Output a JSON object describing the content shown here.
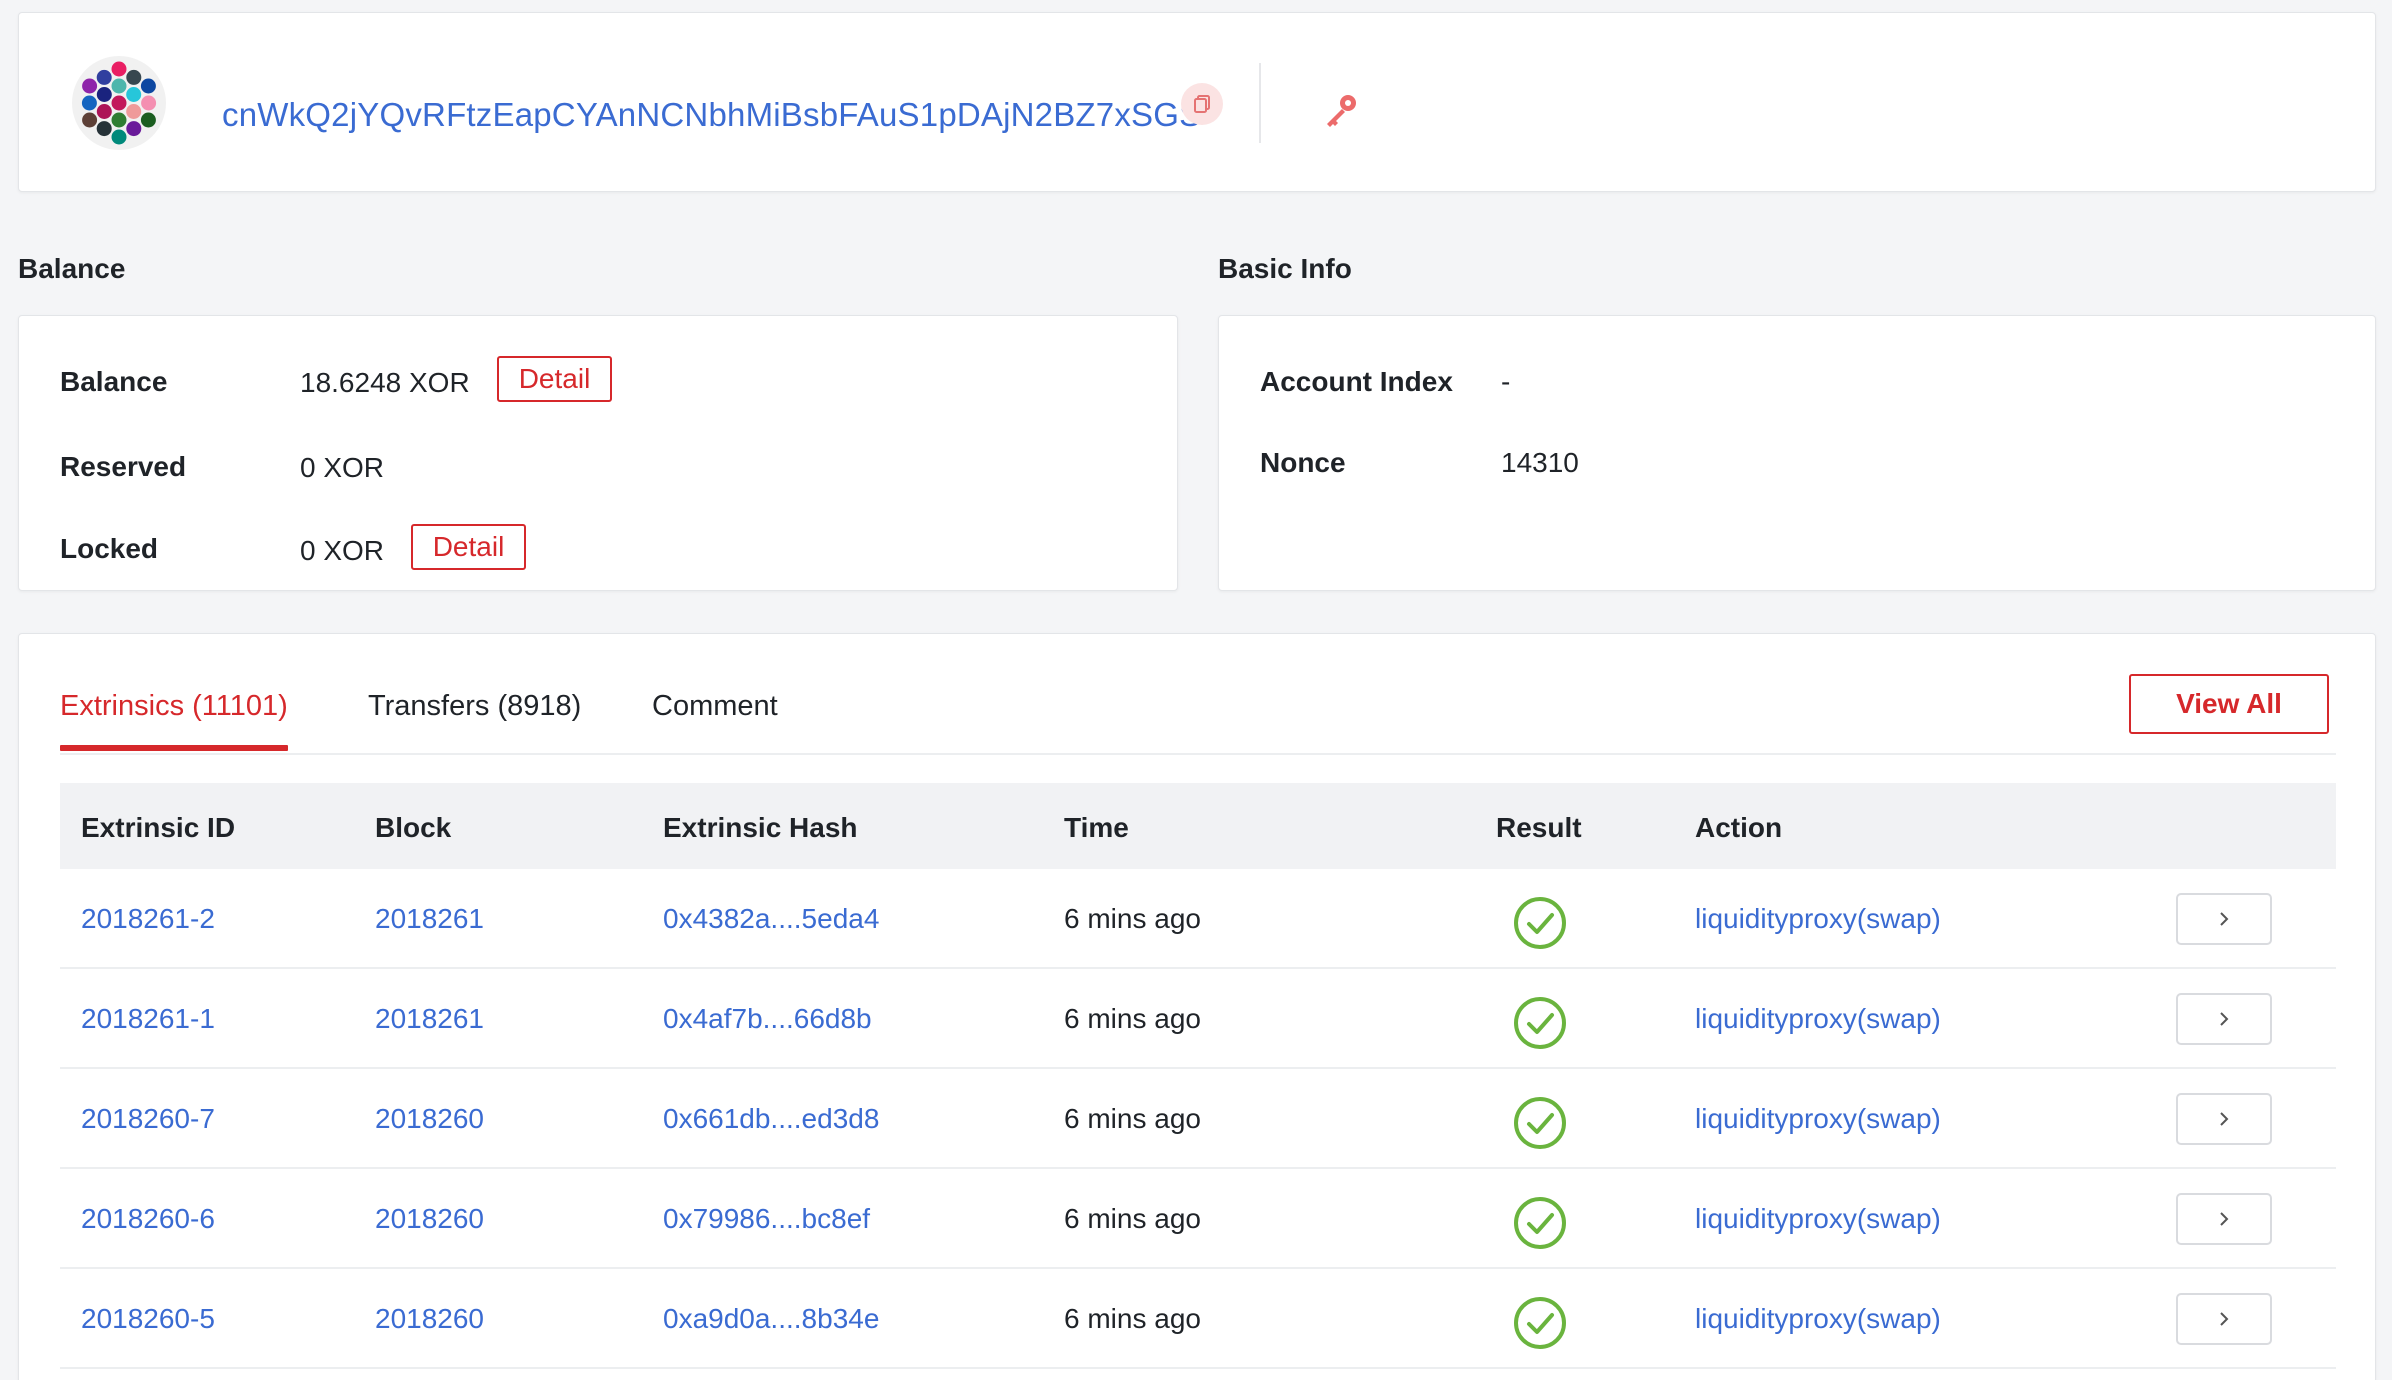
{
  "account": {
    "address": "cnWkQ2jYQvRFtzEapCYAnNCNbhMiBsbFAuS1pDAjN2BZ7xSGS",
    "identicon_colors": [
      "#c2185b",
      "#4db6ac",
      "#1a237e",
      "#ad1457",
      "#2e7d32",
      "#ef9a9a",
      "#26c6da",
      "#e91e63",
      "#303f9f",
      "#8e24aa",
      "#1565c0",
      "#5d4037",
      "#263238",
      "#00897b",
      "#6a1b9a",
      "#1b5e20",
      "#f48fb1",
      "#0d47a1",
      "#37474f"
    ]
  },
  "balance": {
    "section_title": "Balance",
    "rows": [
      {
        "label": "Balance",
        "value": "18.6248 XOR",
        "button": "Detail"
      },
      {
        "label": "Reserved",
        "value": "0 XOR"
      },
      {
        "label": "Locked",
        "value": "0 XOR",
        "button": "Detail"
      }
    ]
  },
  "basic_info": {
    "section_title": "Basic Info",
    "rows": [
      {
        "label": "Account Index",
        "value": "-"
      },
      {
        "label": "Nonce",
        "value": "14310"
      }
    ]
  },
  "tabs": [
    {
      "label": "Extrinsics (11101)",
      "active": true
    },
    {
      "label": "Transfers (8918)",
      "active": false
    },
    {
      "label": "Comment",
      "active": false
    }
  ],
  "view_all_label": "View All",
  "table": {
    "headers": [
      "Extrinsic ID",
      "Block",
      "Extrinsic Hash",
      "Time",
      "Result",
      "Action"
    ],
    "rows": [
      {
        "id": "2018261-2",
        "block": "2018261",
        "hash": "0x4382a....5eda4",
        "time": "6 mins ago",
        "result": "success",
        "action": "liquidityproxy(swap)"
      },
      {
        "id": "2018261-1",
        "block": "2018261",
        "hash": "0x4af7b....66d8b",
        "time": "6 mins ago",
        "result": "success",
        "action": "liquidityproxy(swap)"
      },
      {
        "id": "2018260-7",
        "block": "2018260",
        "hash": "0x661db....ed3d8",
        "time": "6 mins ago",
        "result": "success",
        "action": "liquidityproxy(swap)"
      },
      {
        "id": "2018260-6",
        "block": "2018260",
        "hash": "0x79986....bc8ef",
        "time": "6 mins ago",
        "result": "success",
        "action": "liquidityproxy(swap)"
      },
      {
        "id": "2018260-5",
        "block": "2018260",
        "hash": "0xa9d0a....8b34e",
        "time": "6 mins ago",
        "result": "success",
        "action": "liquidityproxy(swap)"
      }
    ]
  },
  "colors": {
    "accent": "#d6282b",
    "link": "#3a6bd2",
    "success": "#6ab43e"
  },
  "icons": {
    "copy": "copy-icon",
    "key": "key-icon",
    "result": "check-circle-icon",
    "row_action": "chevron-right-icon"
  }
}
